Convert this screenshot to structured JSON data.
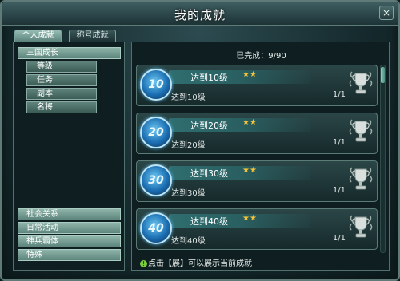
{
  "window": {
    "title": "我的成就",
    "close_icon": "×"
  },
  "tabs": [
    {
      "label": "个人成就",
      "active": true
    },
    {
      "label": "称号成就",
      "active": false
    }
  ],
  "sidebar": {
    "group": "三国成长",
    "sub_items": [
      "等级",
      "任务",
      "副本",
      "名将"
    ],
    "categories": [
      "社会关系",
      "日常活动",
      "神兵霸体",
      "特殊"
    ]
  },
  "main": {
    "progress": "已完成：9/90",
    "achievements": [
      {
        "badge": "10",
        "title": "达到10级",
        "stars": "★★",
        "desc": "达到10级",
        "count": "1/1"
      },
      {
        "badge": "20",
        "title": "达到20级",
        "stars": "★★",
        "desc": "达到20级",
        "count": "1/1"
      },
      {
        "badge": "30",
        "title": "达到30级",
        "stars": "★★",
        "desc": "达到30级",
        "count": "1/1"
      },
      {
        "badge": "40",
        "title": "达到40级",
        "stars": "★★",
        "desc": "达到40级",
        "count": "1/1"
      }
    ],
    "hint": "点击【展】可以展示当前成就"
  },
  "colors": {
    "accent": "#58c2ff",
    "star": "#f2c43a",
    "panel": "#0f1f21"
  }
}
